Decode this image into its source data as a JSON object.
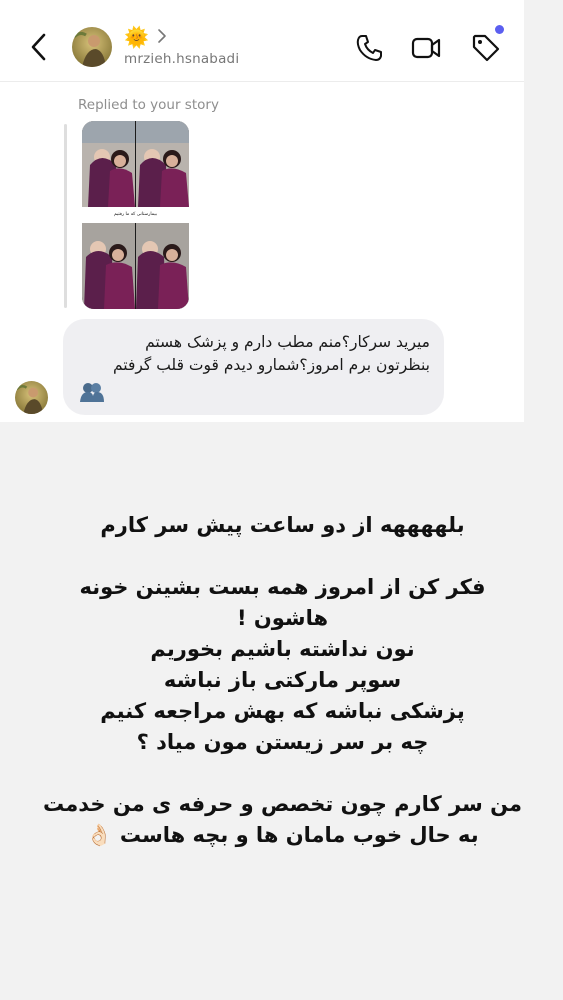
{
  "header": {
    "back_icon": "chevron-left-icon",
    "emoji": "🌞",
    "username": "mrzieh.hsnabadi",
    "icons": [
      "phone-icon",
      "video-icon",
      "tag-icon"
    ],
    "notification_dot_color": "#5b5ff0"
  },
  "thread": {
    "replied_label": "Replied to your story",
    "story_caption": "بیمارستانی که ما رفتیم",
    "message_lines": [
      "میرید سرکار؟منم مطب دارم و پزشک هستم",
      "بنظرتون برم امروز؟شمارو دیدم قوت قلب گرفتم"
    ],
    "message_emoji": "🫂"
  },
  "story_overlay": {
    "line1": "بلههههه از دو ساعت پیش سر کارم",
    "line2": "فکر کن از امروز همه بست بشینن خونه",
    "line3": "هاشون !",
    "line4": "نون نداشته باشیم بخوریم",
    "line5": "سوپر مارکتی باز نباشه",
    "line6": "پزشکی نباشه که بهش مراجعه کنیم",
    "line7": "چه بر سر زیستن مون میاد ؟",
    "line8": "من سر کارم چون تخصص و حرفه ی من خدمت",
    "line9": "به حال خوب مامان ها و بچه هاست 👌🏻"
  }
}
